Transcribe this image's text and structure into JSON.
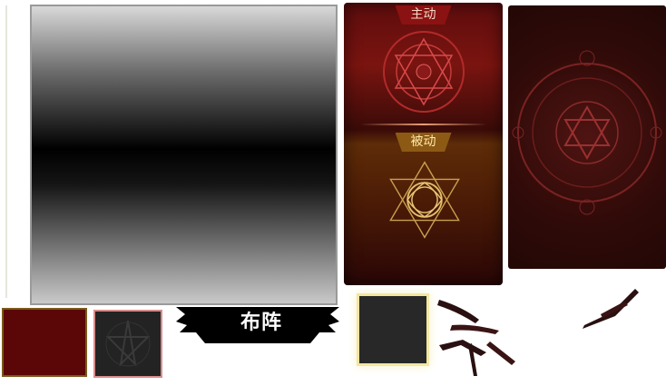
{
  "skill_card": {
    "active_label": "主动",
    "passive_label": "被动"
  },
  "banner": {
    "title": "布阵"
  },
  "colors": {
    "active_red": "#8b1212",
    "passive_gold": "#8c5a14",
    "slot_glow": "#f3e6a0",
    "pentagram_border": "#d98c8c"
  }
}
